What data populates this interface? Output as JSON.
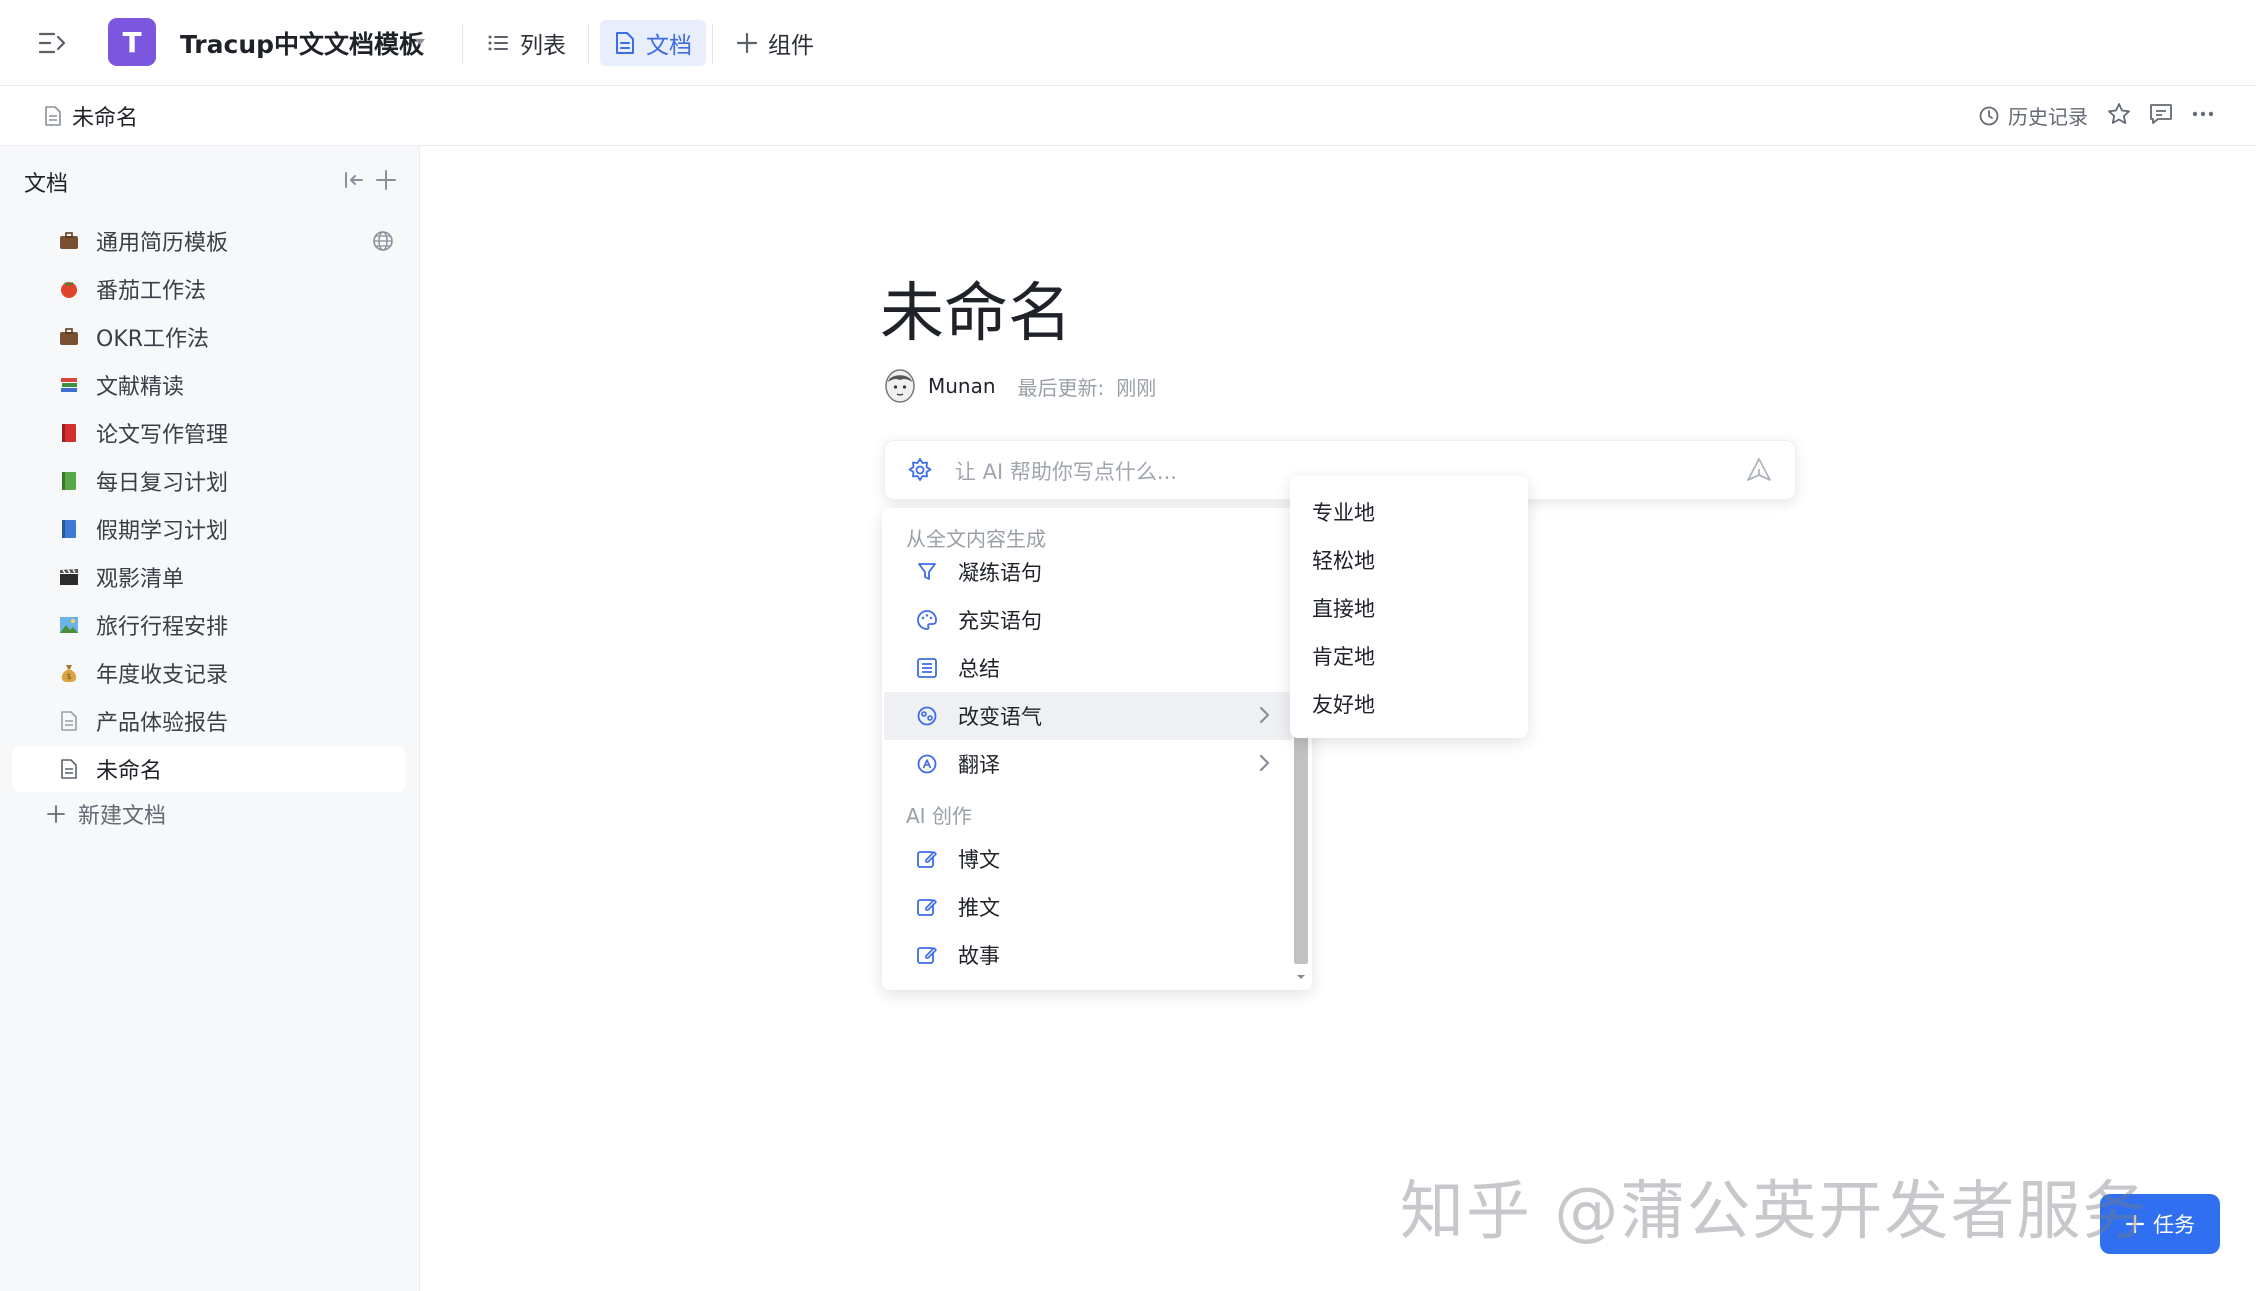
{
  "topbar": {
    "logo_letter": "T",
    "workspace_title": "Tracup中文文档模板",
    "tabs": [
      {
        "label": "列表",
        "icon": "list-icon"
      },
      {
        "label": "文档",
        "icon": "document-icon"
      },
      {
        "label": "组件",
        "icon": "plus-icon"
      }
    ]
  },
  "subbar": {
    "breadcrumb": "未命名",
    "history_label": "历史记录"
  },
  "sidebar": {
    "heading": "文档",
    "items": [
      {
        "label": "通用简历模板",
        "icon": "briefcase-icon"
      },
      {
        "label": "番茄工作法",
        "icon": "tomato-icon"
      },
      {
        "label": "OKR工作法",
        "icon": "briefcase-icon"
      },
      {
        "label": "文献精读",
        "icon": "books-icon"
      },
      {
        "label": "论文写作管理",
        "icon": "red-book-icon"
      },
      {
        "label": "每日复习计划",
        "icon": "green-book-icon"
      },
      {
        "label": "假期学习计划",
        "icon": "blue-book-icon"
      },
      {
        "label": "观影清单",
        "icon": "clapper-icon"
      },
      {
        "label": "旅行行程安排",
        "icon": "landscape-icon"
      },
      {
        "label": "年度收支记录",
        "icon": "money-bag-icon"
      },
      {
        "label": "产品体验报告",
        "icon": "document-icon"
      },
      {
        "label": "未命名",
        "icon": "document-icon"
      }
    ],
    "new_doc_label": "新建文档"
  },
  "document": {
    "title": "未命名",
    "author": "Munan",
    "updated_label": "最后更新:",
    "updated_value": "刚刚"
  },
  "ai": {
    "placeholder": "让 AI 帮助你写点什么...",
    "group1": "从全文内容生成",
    "group1_items": [
      "凝练语句",
      "充实语句",
      "总结",
      "改变语气",
      "翻译"
    ],
    "group2": "AI 创作",
    "group2_items": [
      "博文",
      "推文",
      "故事"
    ],
    "tone_options": [
      "专业地",
      "轻松地",
      "直接地",
      "肯定地",
      "友好地"
    ]
  },
  "watermark": "知乎 @蒲公英开发者服务",
  "fab_label": "任务",
  "colors": {
    "accent": "#3e6be6",
    "logo": "#7b57e0",
    "fab": "#2f6ff0"
  }
}
